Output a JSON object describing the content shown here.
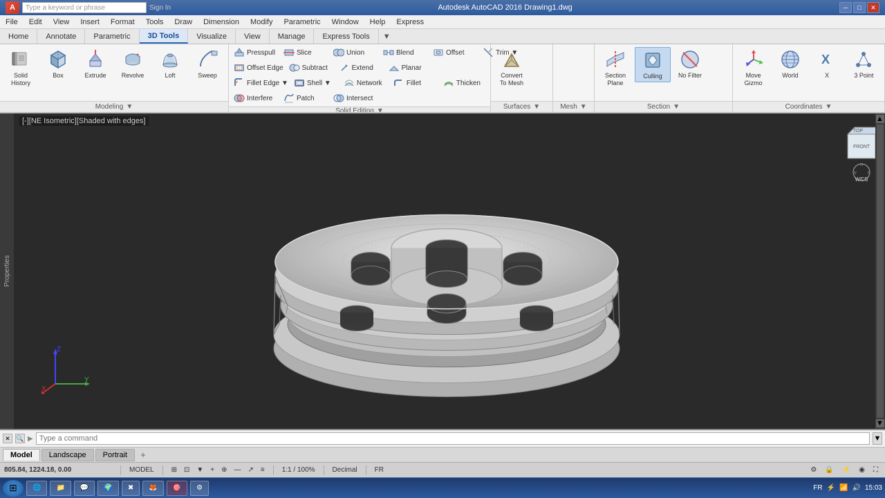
{
  "app": {
    "title": "Autodesk AutoCAD 2016  Drawing1.dwg",
    "search_placeholder": "Type a keyword or phrase",
    "sign_in_label": "Sign In"
  },
  "menu": {
    "items": [
      "File",
      "Edit",
      "View",
      "Insert",
      "Format",
      "Tools",
      "Draw",
      "Dimension",
      "Modify",
      "Parametric",
      "Window",
      "Help",
      "Express"
    ]
  },
  "tabs": {
    "items": [
      "Home",
      "Annotate",
      "Parametric",
      "3D Tools",
      "Visualize",
      "View",
      "Manage",
      "Express Tools"
    ],
    "active": "3D Tools",
    "extra": "▼"
  },
  "ribbon": {
    "groups": [
      {
        "name": "Modeling",
        "buttons_large": [
          {
            "id": "solid-history",
            "label": "Solid\nHistory",
            "icon": "solid-history-icon"
          },
          {
            "id": "box",
            "label": "Box",
            "icon": "box-icon"
          },
          {
            "id": "extrude",
            "label": "Extrude",
            "icon": "extrude-icon"
          },
          {
            "id": "revolve",
            "label": "Revolve",
            "icon": "revolve-icon"
          },
          {
            "id": "loft",
            "label": "Loft",
            "icon": "loft-icon"
          },
          {
            "id": "sweep",
            "label": "Sweep",
            "icon": "sweep-icon"
          }
        ],
        "has_dropdown": true
      },
      {
        "name": "Solid Editing",
        "rows": [
          [
            {
              "id": "presspull",
              "label": "Presspull",
              "icon": "presspull-icon"
            },
            {
              "id": "union",
              "label": "Union",
              "icon": "union-icon"
            },
            {
              "id": "blend",
              "label": "Blend",
              "icon": "blend-icon"
            },
            {
              "id": "offset",
              "label": "Offset",
              "icon": "offset-icon"
            },
            {
              "id": "trim",
              "label": "Trim",
              "icon": "trim-icon"
            }
          ],
          [
            {
              "id": "offset-edge",
              "label": "Offset Edge",
              "icon": "offset-edge-icon"
            },
            {
              "id": "subtract",
              "label": "Subtract",
              "icon": "subtract-icon"
            },
            {
              "id": "extend",
              "label": "Extend",
              "icon": "extend-icon"
            },
            {
              "id": "planar",
              "label": "Planar",
              "icon": "planar-icon"
            }
          ],
          [
            {
              "id": "fillet-edge",
              "label": "Fillet Edge",
              "icon": "fillet-edge-icon"
            },
            {
              "id": "shell",
              "label": "Shell",
              "icon": "shell-icon"
            },
            {
              "id": "network",
              "label": "Network",
              "icon": "network-icon"
            },
            {
              "id": "fillet",
              "label": "Fillet",
              "icon": "fillet-icon"
            },
            {
              "id": "thicken",
              "label": "Thicken",
              "icon": "thicken-icon"
            }
          ],
          [
            {
              "id": "interfere",
              "label": "Interfere",
              "icon": "interfere-icon"
            },
            {
              "id": "patch",
              "label": "Patch",
              "icon": "patch-icon"
            },
            {
              "id": "intersect",
              "label": "Intersect",
              "icon": "intersect-icon"
            }
          ]
        ],
        "has_dropdown": true
      },
      {
        "name": "Surfaces",
        "buttons_large": [
          {
            "id": "convert-to-mesh",
            "label": "Convert\nTo Mesh",
            "icon": "convert-mesh-icon"
          }
        ],
        "has_dropdown": true
      },
      {
        "name": "Mesh",
        "has_dropdown": true
      },
      {
        "name": "Section",
        "buttons_large": [
          {
            "id": "section-plane",
            "label": "Section\nPlane",
            "icon": "section-plane-icon"
          },
          {
            "id": "culling",
            "label": "Culling",
            "icon": "culling-icon",
            "active": true
          },
          {
            "id": "no-filter",
            "label": "No Filter",
            "icon": "no-filter-icon"
          }
        ],
        "has_dropdown": true
      },
      {
        "name": "Coordinates",
        "buttons_large": [
          {
            "id": "move-gizmo",
            "label": "Move\nGizmo",
            "icon": "move-gizmo-icon"
          },
          {
            "id": "world",
            "label": "World",
            "icon": "world-icon"
          },
          {
            "id": "x",
            "label": "X",
            "icon": "x-icon"
          },
          {
            "id": "3point",
            "label": "3 Point",
            "icon": "3point-icon"
          }
        ],
        "has_dropdown": true
      }
    ]
  },
  "viewport": {
    "label": "[-][NE Isometric][Shaded with edges]"
  },
  "statusbar": {
    "coords": "805.84, 1224.18, 0.00",
    "model_label": "MODEL",
    "scale": "1:1 / 100%",
    "units": "Decimal",
    "lang": "FR"
  },
  "bottom_tabs": {
    "items": [
      "Model",
      "Landscape",
      "Portrait"
    ],
    "active": "Model",
    "add": "+"
  },
  "cmd": {
    "placeholder": "Type a command"
  },
  "taskbar": {
    "time": "15:03",
    "apps": [
      "⊞",
      "🌐",
      "📁",
      "💬",
      "🌍",
      "✖",
      "🔥",
      "🔧",
      "🎯"
    ]
  }
}
